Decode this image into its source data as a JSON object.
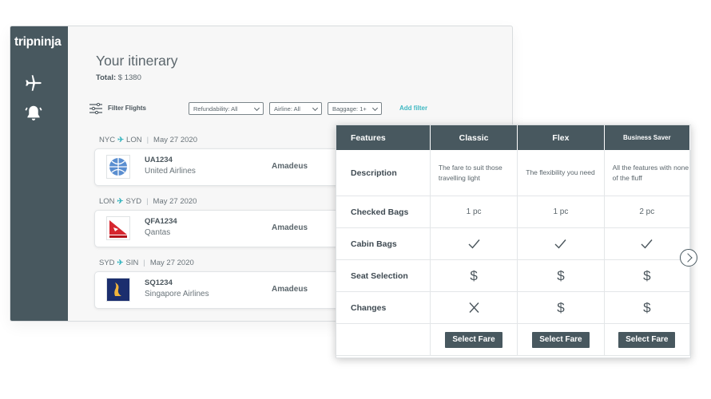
{
  "app": {
    "brand": "tripninja"
  },
  "sidebar": {
    "icons": [
      "airplane-icon",
      "bell-icon"
    ]
  },
  "itinerary": {
    "title": "Your itinerary",
    "total_label": "Total:",
    "total_value": "$ 1380"
  },
  "filters": {
    "label": "Filter Flights",
    "refundability": "Refundability: All",
    "airline": "Airline: All",
    "baggage": "Baggage: 1+",
    "add": "Add filter"
  },
  "segments": [
    {
      "from": "NYC",
      "to": "LON",
      "date": "May 27 2020",
      "flight": "UA1234",
      "airline": "United Airlines",
      "source": "Amadeus",
      "logo": "united-logo"
    },
    {
      "from": "LON",
      "to": "SYD",
      "date": "May 27 2020",
      "flight": "QFA1234",
      "airline": "Qantas",
      "source": "Amadeus",
      "logo": "qantas-logo"
    },
    {
      "from": "SYD",
      "to": "SIN",
      "date": "May 27 2020",
      "flight": "SQ1234",
      "airline": "Singapore Airlines",
      "source": "Amadeus",
      "logo": "singapore-logo"
    }
  ],
  "fares": {
    "header": [
      "Features",
      "Classic",
      "Flex",
      "Business Saver"
    ],
    "description_label": "Description",
    "descriptions": [
      "The fare to suit those travelling light",
      "The flexibility you need",
      "All the features with none of the fluff"
    ],
    "checked_label": "Checked Bags",
    "checked": [
      "1 pc",
      "1 pc",
      "2 pc"
    ],
    "cabin_label": "Cabin Bags",
    "cabin": [
      "check",
      "check",
      "check"
    ],
    "seat_label": "Seat Selection",
    "seat": [
      "$",
      "$",
      "$"
    ],
    "changes_label": "Changes",
    "changes_first": "cross",
    "changes": [
      "$",
      "$"
    ],
    "select_label": "Select Fare"
  },
  "colors": {
    "sidebar": "#48585f",
    "accent": "#3fb8c2"
  }
}
